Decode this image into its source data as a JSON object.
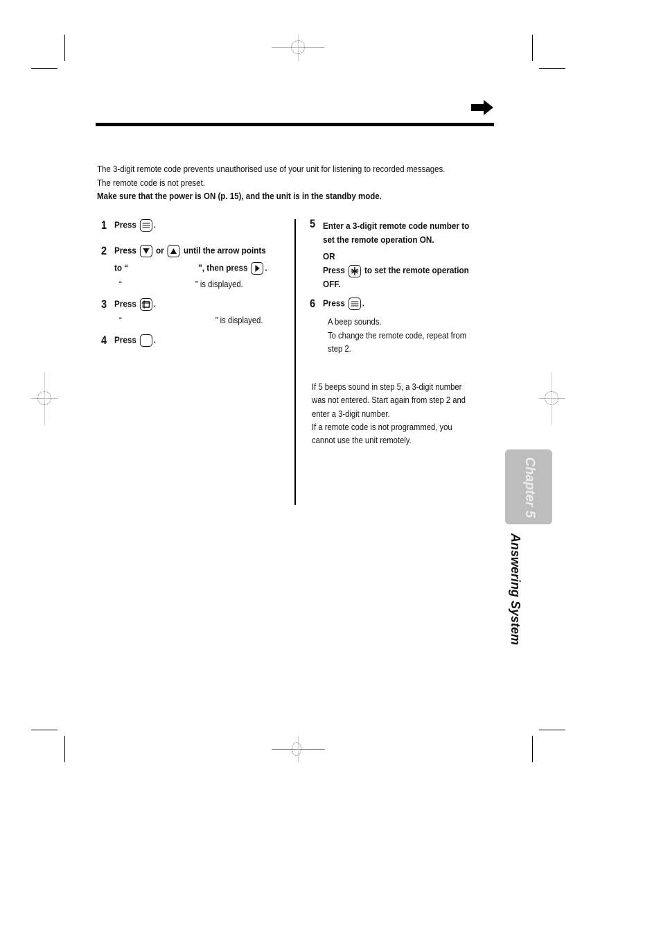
{
  "page": {
    "intro": {
      "line1": "The 3-digit remote code prevents unauthorised use of your unit for listening to recorded messages.",
      "line2": "The remote code is not preset.",
      "line3": "Make sure that the power is ON (p. 15), and the unit is in the standby mode."
    },
    "steps": [
      {
        "num": "1",
        "text_a": "Press",
        "icon": "menu-key-icon",
        "text_b": "."
      },
      {
        "num": "2",
        "text_a": "Press",
        "icon_a": "down-key-icon",
        "or": "or",
        "icon_b": "up-key-icon",
        "text_b": "until the arrow points",
        "line2_a": "to “",
        "line2_b": "”, then press",
        "icon_c": "right-key-icon",
        "line2_c": ".",
        "note_open": "“",
        "note_close": "” is displayed."
      },
      {
        "num": "3",
        "text_a": "Press",
        "icon": "program-key-icon",
        "text_b": ".",
        "note_open": "“",
        "note_close": "” is displayed."
      },
      {
        "num": "4",
        "text_a": "Press",
        "icon": "blank-key-icon",
        "text_b": "."
      },
      {
        "num": "5",
        "line1": "Enter a 3-digit remote code number to",
        "line2": "set the remote operation ON.",
        "or": "OR",
        "line3_a": "Press",
        "icon": "star-key-icon",
        "line3_b": "to set the remote operation",
        "line4": "OFF."
      },
      {
        "num": "6",
        "text_a": "Press",
        "icon": "menu-key-icon",
        "text_b": ".",
        "note1": "A beep sounds.",
        "note2": "To change the remote code, repeat from",
        "note3": "step 2."
      }
    ],
    "notes": {
      "line1": "If 5 beeps sound in step 5, a 3-digit number",
      "line2": "was not entered. Start again from step 2 and",
      "line3": "enter a 3-digit number.",
      "line4": "If a remote code is not programmed, you",
      "line5": "cannot use the unit remotely."
    },
    "side_tab": {
      "chapter": "Chapter 5",
      "section": "Answering System"
    },
    "colors": {
      "tab_bg": "#bdbdbd",
      "text": "#111111"
    }
  }
}
